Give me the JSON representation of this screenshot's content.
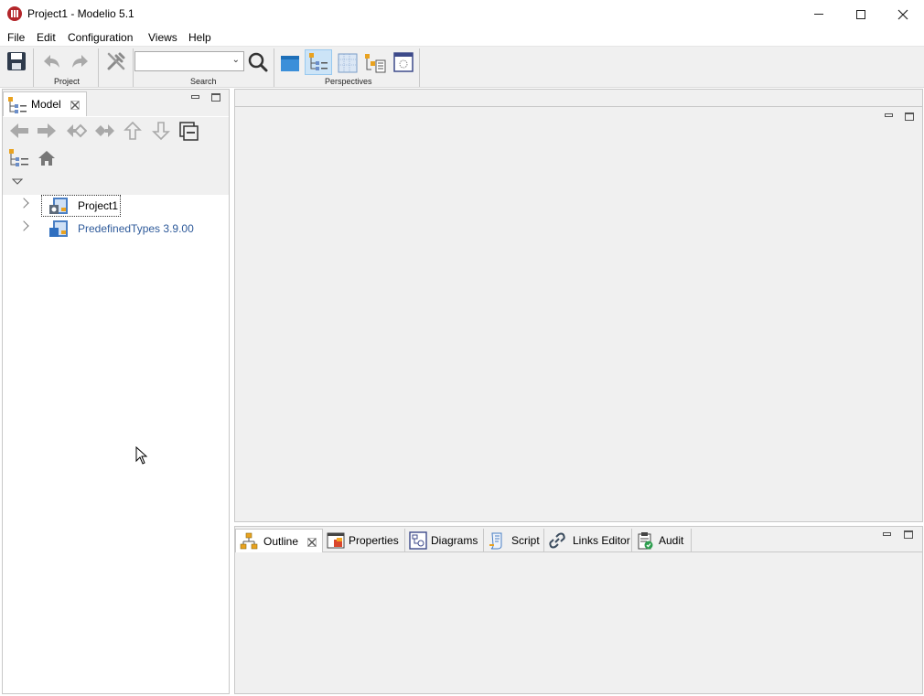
{
  "window": {
    "title": "Project1 - Modelio 5.1"
  },
  "menu": {
    "items": [
      "File",
      "Edit",
      "Configuration",
      "Views",
      "Help"
    ]
  },
  "toolbar": {
    "group_project": "Project",
    "group_search": "Search",
    "group_perspectives": "Perspectives",
    "search_value": ""
  },
  "model_panel": {
    "tab_label": "Model",
    "tree": [
      {
        "label": "Project1",
        "selected": true
      },
      {
        "label": "PredefinedTypes 3.9.00",
        "selected": false
      }
    ]
  },
  "bottom_panel": {
    "tabs": [
      {
        "label": "Outline",
        "active": true
      },
      {
        "label": "Properties",
        "active": false
      },
      {
        "label": "Diagrams",
        "active": false
      },
      {
        "label": "Script",
        "active": false
      },
      {
        "label": "Links Editor",
        "active": false
      },
      {
        "label": "Audit",
        "active": false
      }
    ]
  },
  "colors": {
    "accent_blue": "#2b6cb0",
    "brand_red": "#b3262a",
    "tree_link": "#2e5a9a"
  }
}
